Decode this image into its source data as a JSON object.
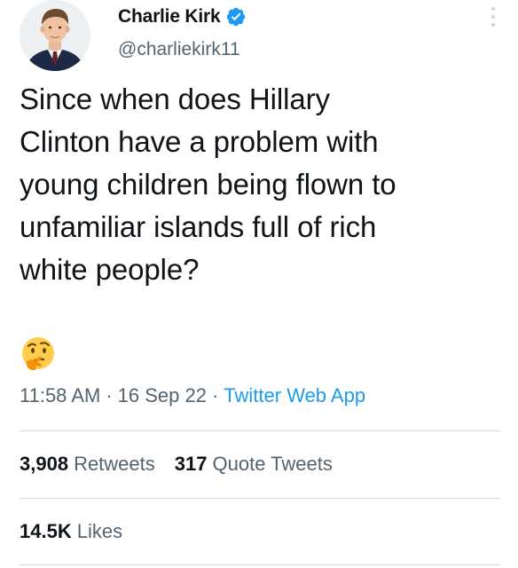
{
  "user": {
    "display_name": "Charlie Kirk",
    "handle": "@charliekirk11",
    "verified": true
  },
  "tweet": {
    "text": "Since when does Hillary\nClinton have a problem with\nyoung children being flown to\nunfamiliar islands full of rich\nwhite people?",
    "emoji": "thinking-face-icon"
  },
  "meta": {
    "time": "11:58 AM",
    "date": "16 Sep 22",
    "source": "Twitter Web App",
    "separator": "·"
  },
  "stats": {
    "retweets": {
      "count": "3,908",
      "label": "Retweets"
    },
    "quotes": {
      "count": "317",
      "label": "Quote Tweets"
    },
    "likes": {
      "count": "14.5K",
      "label": "Likes"
    }
  },
  "colors": {
    "accent": "#1d9bf0",
    "text": "#0f1419",
    "muted": "#536471",
    "divider": "#cfd9de"
  }
}
